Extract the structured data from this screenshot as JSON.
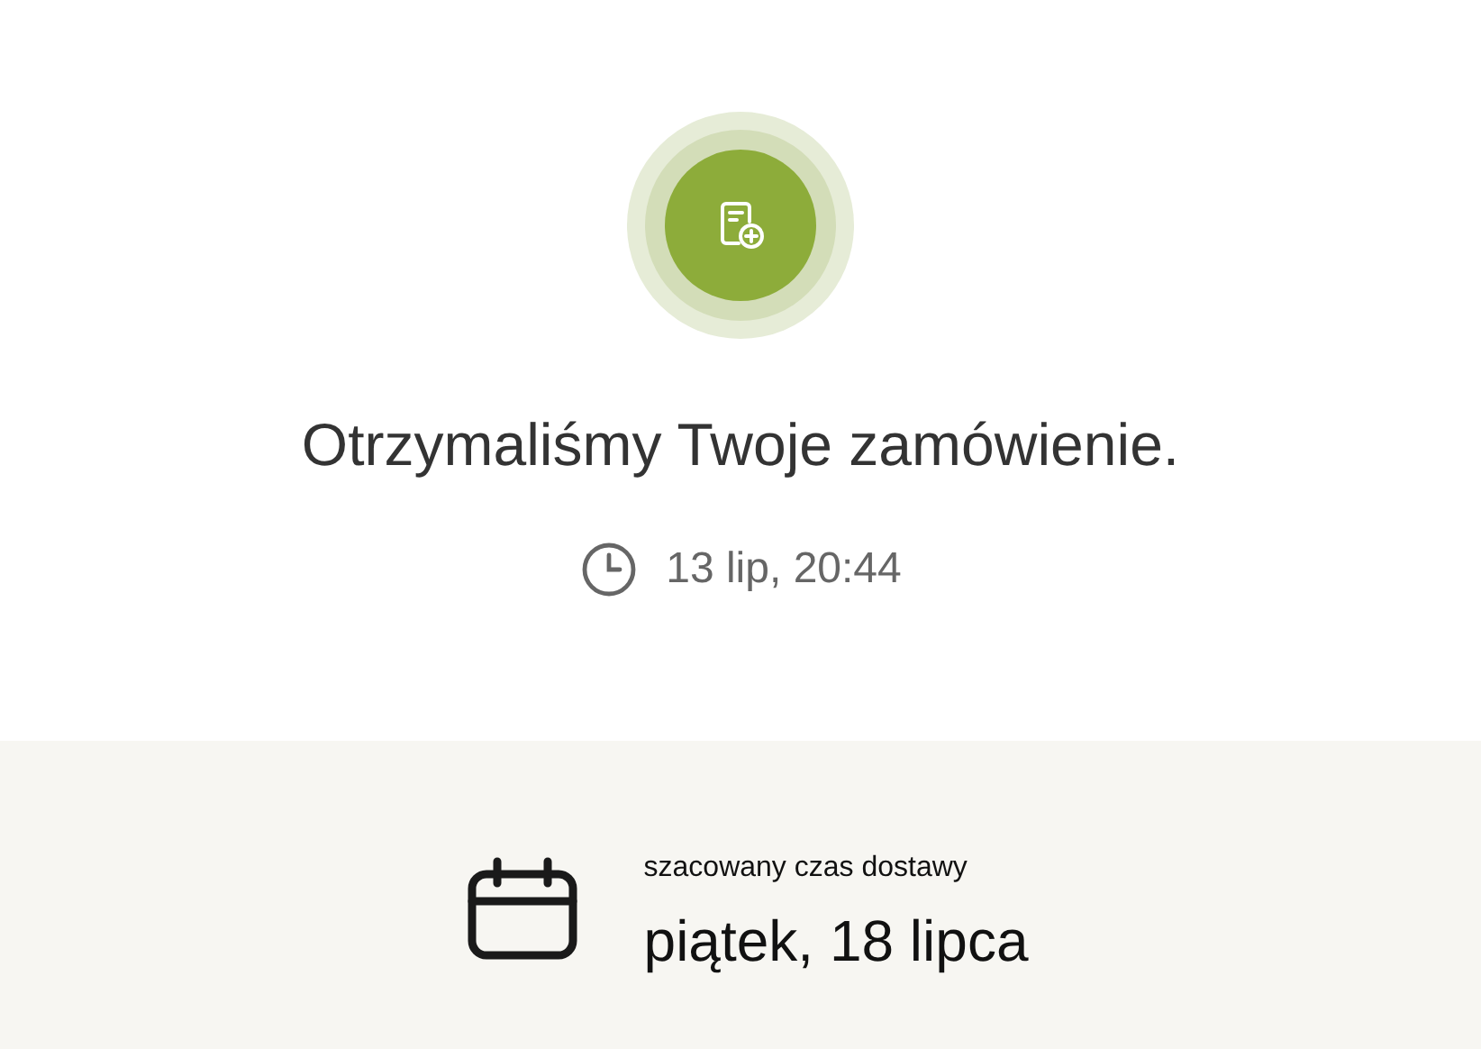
{
  "confirmation": {
    "title": "Otrzymaliśmy Twoje zamówienie.",
    "time": "13 lip, 20:44"
  },
  "delivery": {
    "label": "szacowany czas dostawy",
    "date": "piątek, 18 lipca"
  }
}
